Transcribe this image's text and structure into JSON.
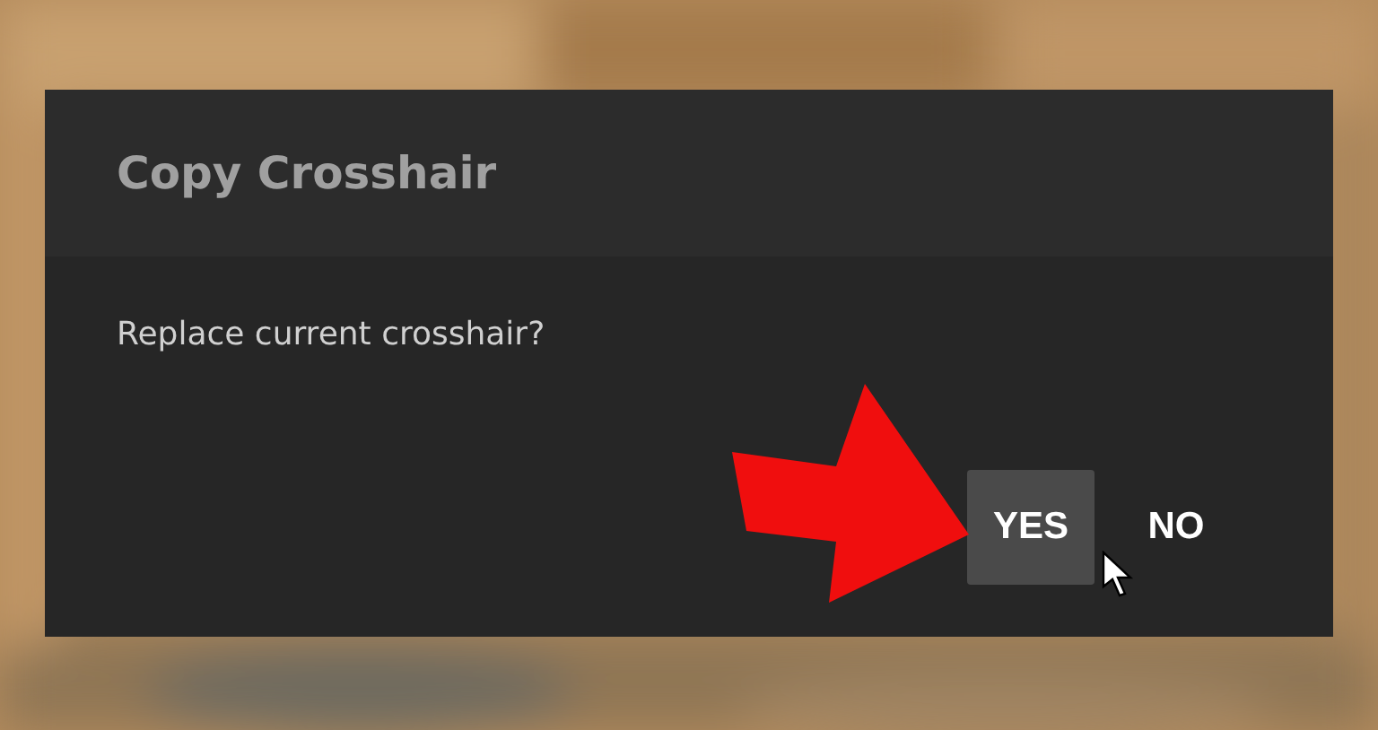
{
  "dialog": {
    "title": "Copy Crosshair",
    "message": "Replace current crosshair?",
    "buttons": [
      {
        "label": "YES",
        "selected": true
      },
      {
        "label": "NO",
        "selected": false
      }
    ]
  }
}
